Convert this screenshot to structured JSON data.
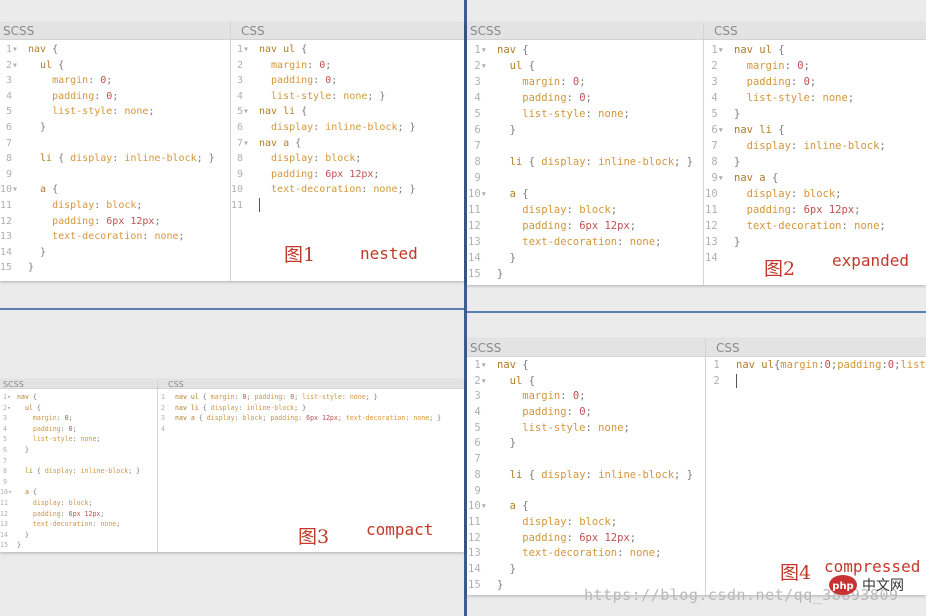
{
  "headers": {
    "scss": "SCSS",
    "css": "CSS"
  },
  "scss_code": [
    [
      [
        "sel",
        "nav "
      ],
      [
        "pun",
        "{"
      ]
    ],
    [
      [
        "sel",
        "  ul "
      ],
      [
        "pun",
        "{"
      ]
    ],
    [
      [
        "prop",
        "    margin"
      ],
      [
        "pun",
        ": "
      ],
      [
        "num",
        "0"
      ],
      [
        "pun",
        ";"
      ]
    ],
    [
      [
        "prop",
        "    padding"
      ],
      [
        "pun",
        ": "
      ],
      [
        "num",
        "0"
      ],
      [
        "pun",
        ";"
      ]
    ],
    [
      [
        "prop",
        "    list-style"
      ],
      [
        "pun",
        ": "
      ],
      [
        "val",
        "none"
      ],
      [
        "pun",
        ";"
      ]
    ],
    [
      [
        "pun",
        "  }"
      ]
    ],
    [],
    [
      [
        "sel",
        "  li "
      ],
      [
        "pun",
        "{ "
      ],
      [
        "prop",
        "display"
      ],
      [
        "pun",
        ": "
      ],
      [
        "val",
        "inline-block"
      ],
      [
        "pun",
        "; }"
      ]
    ],
    [],
    [
      [
        "sel",
        "  a "
      ],
      [
        "pun",
        "{"
      ]
    ],
    [
      [
        "prop",
        "    display"
      ],
      [
        "pun",
        ": "
      ],
      [
        "val",
        "block"
      ],
      [
        "pun",
        ";"
      ]
    ],
    [
      [
        "prop",
        "    padding"
      ],
      [
        "pun",
        ": "
      ],
      [
        "num",
        "6px 12px"
      ],
      [
        "pun",
        ";"
      ]
    ],
    [
      [
        "prop",
        "    text-decoration"
      ],
      [
        "pun",
        ": "
      ],
      [
        "val",
        "none"
      ],
      [
        "pun",
        ";"
      ]
    ],
    [
      [
        "pun",
        "  }"
      ]
    ],
    [
      [
        "pun",
        "}"
      ]
    ]
  ],
  "scss_folds": [
    1,
    2,
    10
  ],
  "panels": [
    {
      "label_zh": "图1",
      "label_en": "nested",
      "css_folds": [
        1,
        5,
        7
      ],
      "css_code": [
        [
          [
            "sel",
            "nav ul "
          ],
          [
            "pun",
            "{"
          ]
        ],
        [
          [
            "prop",
            "  margin"
          ],
          [
            "pun",
            ": "
          ],
          [
            "num",
            "0"
          ],
          [
            "pun",
            ";"
          ]
        ],
        [
          [
            "prop",
            "  padding"
          ],
          [
            "pun",
            ": "
          ],
          [
            "num",
            "0"
          ],
          [
            "pun",
            ";"
          ]
        ],
        [
          [
            "prop",
            "  list-style"
          ],
          [
            "pun",
            ": "
          ],
          [
            "val",
            "none"
          ],
          [
            "pun",
            "; }"
          ]
        ],
        [
          [
            "sel",
            "nav li "
          ],
          [
            "pun",
            "{"
          ]
        ],
        [
          [
            "prop",
            "  display"
          ],
          [
            "pun",
            ": "
          ],
          [
            "val",
            "inline-block"
          ],
          [
            "pun",
            "; }"
          ]
        ],
        [
          [
            "sel",
            "nav a "
          ],
          [
            "pun",
            "{"
          ]
        ],
        [
          [
            "prop",
            "  display"
          ],
          [
            "pun",
            ": "
          ],
          [
            "val",
            "block"
          ],
          [
            "pun",
            ";"
          ]
        ],
        [
          [
            "prop",
            "  padding"
          ],
          [
            "pun",
            ": "
          ],
          [
            "num",
            "6px 12px"
          ],
          [
            "pun",
            ";"
          ]
        ],
        [
          [
            "prop",
            "  text-decoration"
          ],
          [
            "pun",
            ": "
          ],
          [
            "val",
            "none"
          ],
          [
            "pun",
            "; }"
          ]
        ],
        []
      ]
    },
    {
      "label_zh": "图2",
      "label_en": "expanded",
      "css_folds": [
        1,
        6,
        9
      ],
      "css_code": [
        [
          [
            "sel",
            "nav ul "
          ],
          [
            "pun",
            "{"
          ]
        ],
        [
          [
            "prop",
            "  margin"
          ],
          [
            "pun",
            ": "
          ],
          [
            "num",
            "0"
          ],
          [
            "pun",
            ";"
          ]
        ],
        [
          [
            "prop",
            "  padding"
          ],
          [
            "pun",
            ": "
          ],
          [
            "num",
            "0"
          ],
          [
            "pun",
            ";"
          ]
        ],
        [
          [
            "prop",
            "  list-style"
          ],
          [
            "pun",
            ": "
          ],
          [
            "val",
            "none"
          ],
          [
            "pun",
            ";"
          ]
        ],
        [
          [
            "pun",
            "}"
          ]
        ],
        [
          [
            "sel",
            "nav li "
          ],
          [
            "pun",
            "{"
          ]
        ],
        [
          [
            "prop",
            "  display"
          ],
          [
            "pun",
            ": "
          ],
          [
            "val",
            "inline-block"
          ],
          [
            "pun",
            ";"
          ]
        ],
        [
          [
            "pun",
            "}"
          ]
        ],
        [
          [
            "sel",
            "nav a "
          ],
          [
            "pun",
            "{"
          ]
        ],
        [
          [
            "prop",
            "  display"
          ],
          [
            "pun",
            ": "
          ],
          [
            "val",
            "block"
          ],
          [
            "pun",
            ";"
          ]
        ],
        [
          [
            "prop",
            "  padding"
          ],
          [
            "pun",
            ": "
          ],
          [
            "num",
            "6px 12px"
          ],
          [
            "pun",
            ";"
          ]
        ],
        [
          [
            "prop",
            "  text-decoration"
          ],
          [
            "pun",
            ": "
          ],
          [
            "val",
            "none"
          ],
          [
            "pun",
            ";"
          ]
        ],
        [
          [
            "pun",
            "}"
          ]
        ],
        []
      ]
    },
    {
      "label_zh": "图3",
      "label_en": "compact",
      "css_folds": [],
      "css_code": [
        [
          [
            "sel",
            "nav ul "
          ],
          [
            "pun",
            "{ "
          ],
          [
            "prop",
            "margin"
          ],
          [
            "pun",
            ": "
          ],
          [
            "num",
            "0"
          ],
          [
            "pun",
            "; "
          ],
          [
            "prop",
            "padding"
          ],
          [
            "pun",
            ": "
          ],
          [
            "num",
            "0"
          ],
          [
            "pun",
            "; "
          ],
          [
            "prop",
            "list-style"
          ],
          [
            "pun",
            ": "
          ],
          [
            "val",
            "none"
          ],
          [
            "pun",
            "; }"
          ]
        ],
        [
          [
            "sel",
            "nav li "
          ],
          [
            "pun",
            "{ "
          ],
          [
            "prop",
            "display"
          ],
          [
            "pun",
            ": "
          ],
          [
            "val",
            "inline-block"
          ],
          [
            "pun",
            "; }"
          ]
        ],
        [
          [
            "sel",
            "nav a "
          ],
          [
            "pun",
            "{ "
          ],
          [
            "prop",
            "display"
          ],
          [
            "pun",
            ": "
          ],
          [
            "val",
            "block"
          ],
          [
            "pun",
            "; "
          ],
          [
            "prop",
            "padding"
          ],
          [
            "pun",
            ": "
          ],
          [
            "num",
            "6px 12px"
          ],
          [
            "pun",
            "; "
          ],
          [
            "prop",
            "text-decoration"
          ],
          [
            "pun",
            ": "
          ],
          [
            "val",
            "none"
          ],
          [
            "pun",
            "; }"
          ]
        ],
        []
      ]
    },
    {
      "label_zh": "图4",
      "label_en": "compressed",
      "css_folds": [],
      "css_code": [
        [
          [
            "sel",
            "nav ul"
          ],
          [
            "pun",
            "{"
          ],
          [
            "prop",
            "margin"
          ],
          [
            "pun",
            ":"
          ],
          [
            "num",
            "0"
          ],
          [
            "pun",
            ";"
          ],
          [
            "prop",
            "padding"
          ],
          [
            "pun",
            ":"
          ],
          [
            "num",
            "0"
          ],
          [
            "pun",
            ";"
          ],
          [
            "prop",
            "list-"
          ]
        ],
        []
      ]
    }
  ],
  "watermark": "https://blog.csdn.net/qq_38893809",
  "logo_text": "php 中文网"
}
